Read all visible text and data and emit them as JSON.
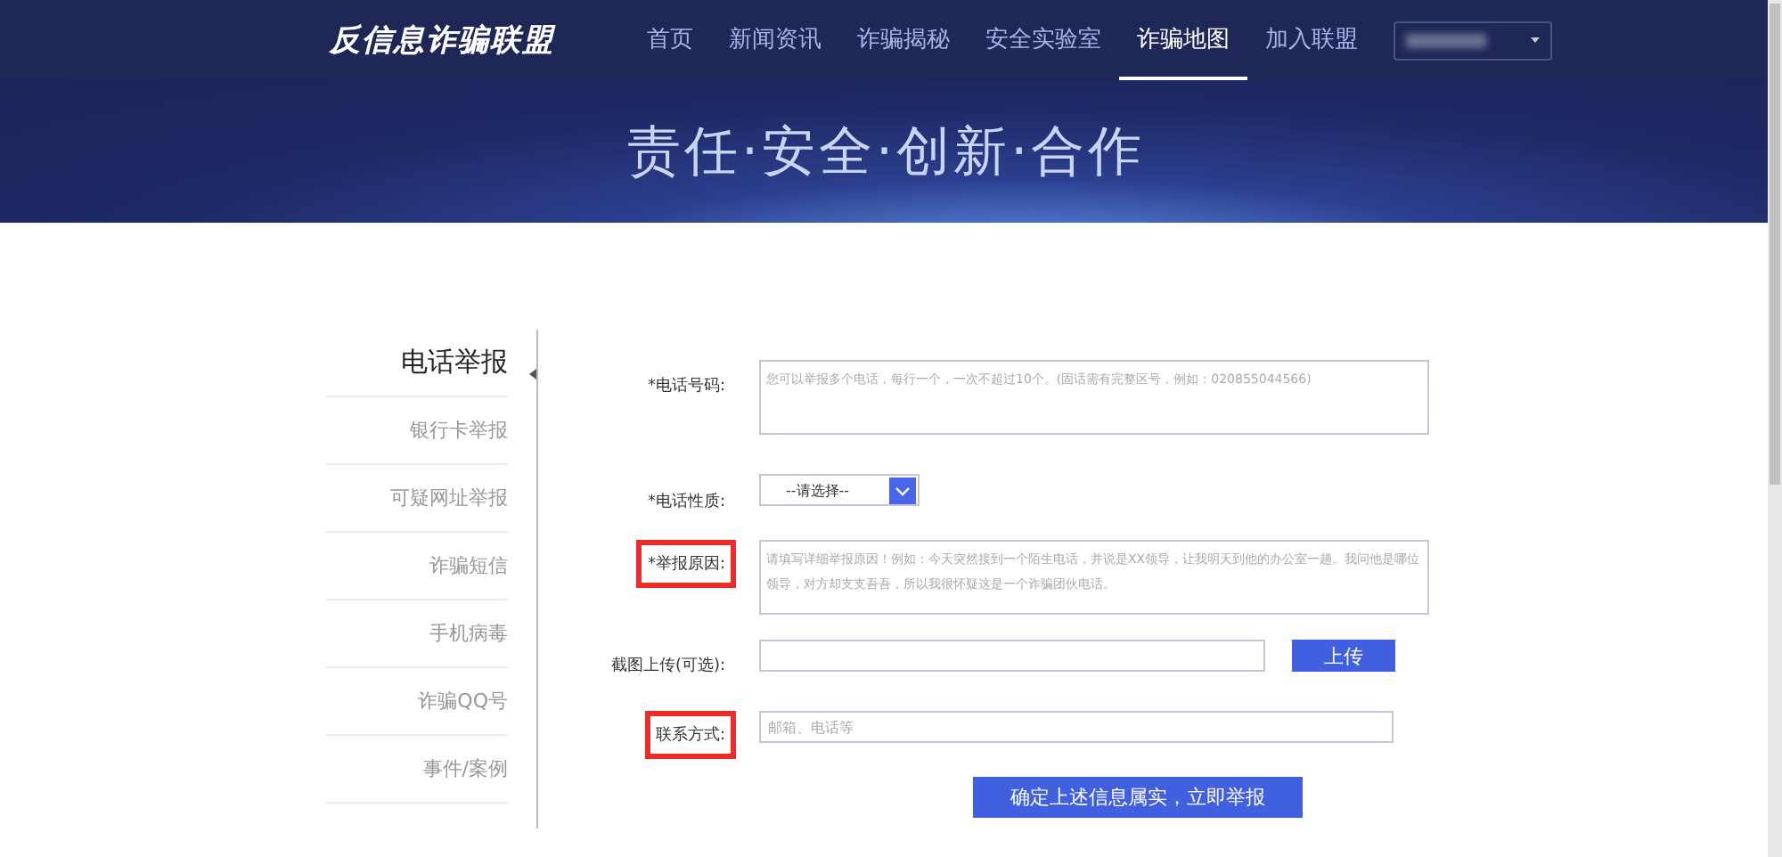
{
  "header": {
    "logo": "反信息诈骗联盟",
    "nav": [
      {
        "label": "首页",
        "selected": false
      },
      {
        "label": "新闻资讯",
        "selected": false
      },
      {
        "label": "诈骗揭秘",
        "selected": false
      },
      {
        "label": "安全实验室",
        "selected": false
      },
      {
        "label": "诈骗地图",
        "selected": true
      },
      {
        "label": "加入联盟",
        "selected": false
      }
    ]
  },
  "banner": {
    "slogan": "责任·安全·创新·合作"
  },
  "sidebar": {
    "items": [
      {
        "label": "电话举报",
        "selected": true
      },
      {
        "label": "银行卡举报",
        "selected": false
      },
      {
        "label": "可疑网址举报",
        "selected": false
      },
      {
        "label": "诈骗短信",
        "selected": false
      },
      {
        "label": "手机病毒",
        "selected": false
      },
      {
        "label": "诈骗QQ号",
        "selected": false
      },
      {
        "label": "事件/案例",
        "selected": false
      }
    ]
  },
  "form": {
    "fields": [
      {
        "kind": "textarea",
        "label": "*电话号码:",
        "placeholder": "您可以举报多个电话，每行一个，一次不超过10个。(固话需有完整区号，例如：020855044566)",
        "highlighted": false
      },
      {
        "kind": "select",
        "label": "*电话性质:",
        "value": "--请选择--",
        "highlighted": false
      },
      {
        "kind": "textarea",
        "label": "*举报原因:",
        "placeholder": "请填写详细举报原因！例如：今天突然接到一个陌生电话，并说是XX领导，让我明天到他的办公室一趟。我问他是哪位领导，对方却支支吾吾，所以我很怀疑这是一个诈骗团伙电话。",
        "highlighted": true
      },
      {
        "kind": "file",
        "label": "截图上传(可选):",
        "button": "上传",
        "highlighted": false
      },
      {
        "kind": "text",
        "label": "联系方式:",
        "placeholder": "邮箱、电话等",
        "highlighted": true
      }
    ],
    "submit": "确定上述信息属实，立即举报"
  }
}
